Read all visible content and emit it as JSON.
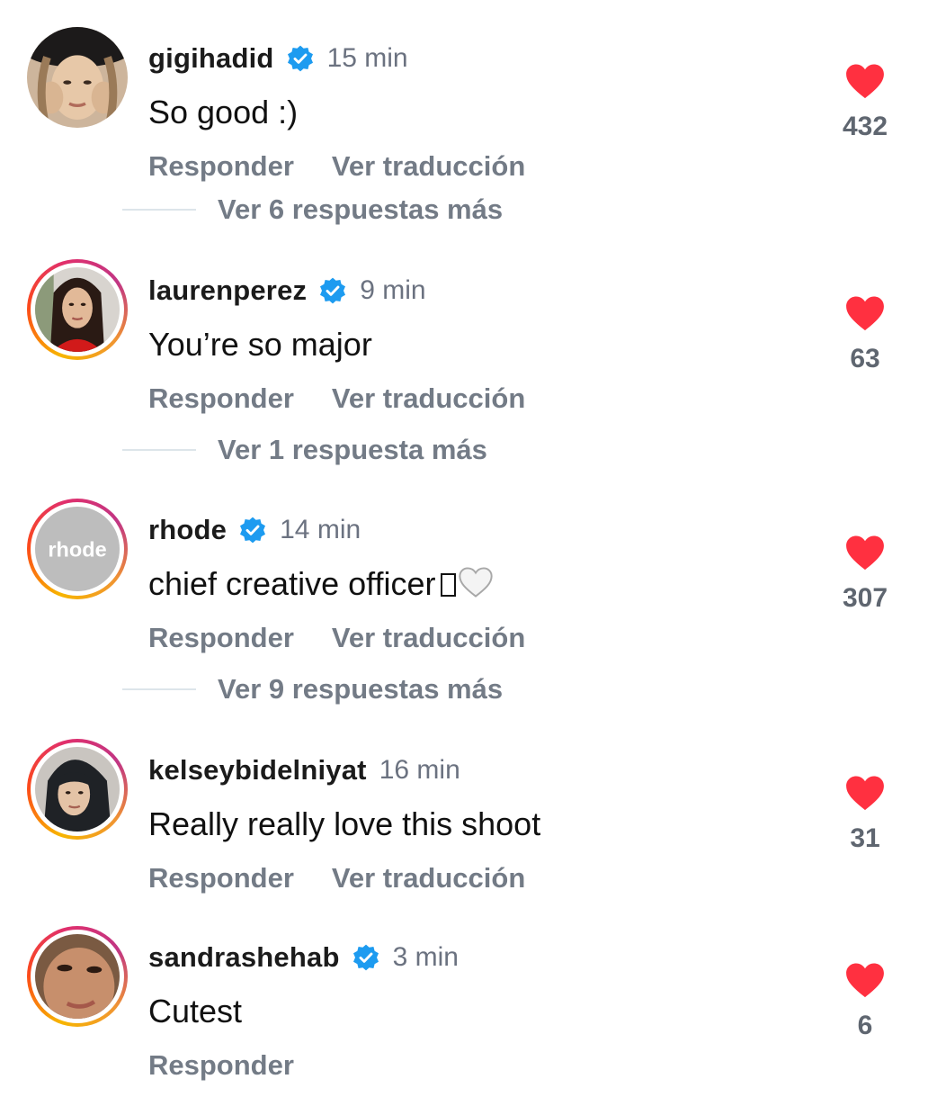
{
  "comments": [
    {
      "username": "gigihadid",
      "verified": true,
      "time": "15 min",
      "text": "So good :)",
      "reply_label": "Responder",
      "translate_label": "Ver traducción",
      "likes": "432",
      "story_ring": false,
      "more_replies": "Ver 6 respuestas más"
    },
    {
      "username": "laurenperez",
      "verified": true,
      "time": "9 min",
      "text": "You’re so major",
      "reply_label": "Responder",
      "translate_label": "Ver traducción",
      "likes": "63",
      "story_ring": true,
      "more_replies": "Ver 1 respuesta más"
    },
    {
      "username": "rhode",
      "verified": true,
      "time": "14 min",
      "text": "chief creative officer",
      "avatar_text": "rhode",
      "reply_label": "Responder",
      "translate_label": "Ver traducción",
      "likes": "307",
      "story_ring": true,
      "more_replies": "Ver 9 respuestas más"
    },
    {
      "username": "kelseybidelniyat",
      "verified": false,
      "time": "16 min",
      "text": "Really really love this shoot",
      "reply_label": "Responder",
      "translate_label": "Ver traducción",
      "likes": "31",
      "story_ring": true
    },
    {
      "username": "sandrashehab",
      "verified": true,
      "time": "3 min",
      "text": "Cutest",
      "reply_label": "Responder",
      "likes": "6",
      "story_ring": true
    }
  ],
  "colors": {
    "verified_badge": "#1d9bf0",
    "like_heart": "#ff3040",
    "secondary_text": "#737b86"
  },
  "icons": {
    "verified": "verified-badge-icon",
    "like": "heart-icon",
    "emoji": "white-heart-emoji"
  }
}
